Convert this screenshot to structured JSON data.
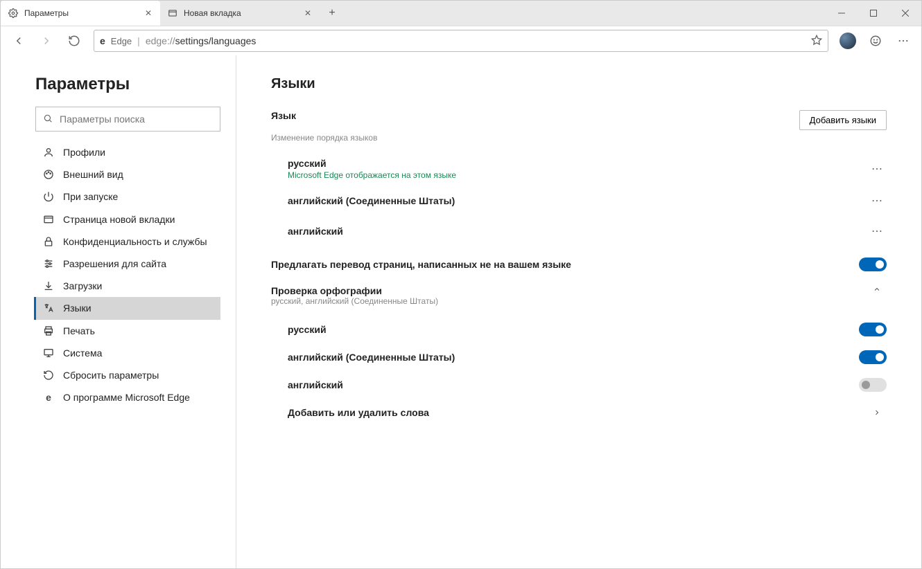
{
  "tabs": [
    {
      "title": "Параметры",
      "active": true
    },
    {
      "title": "Новая вкладка",
      "active": false
    }
  ],
  "toolbar": {
    "app_label": "Edge",
    "url_dim": "edge://",
    "url_path": "settings/languages"
  },
  "sidebar": {
    "title": "Параметры",
    "search_placeholder": "Параметры поиска",
    "items": [
      {
        "id": "profiles",
        "label": "Профили"
      },
      {
        "id": "appearance",
        "label": "Внешний вид"
      },
      {
        "id": "startup",
        "label": "При запуске"
      },
      {
        "id": "newtab",
        "label": "Страница новой вкладки"
      },
      {
        "id": "privacy",
        "label": "Конфиденциальность и службы"
      },
      {
        "id": "site-perm",
        "label": "Разрешения для сайта"
      },
      {
        "id": "downloads",
        "label": "Загрузки"
      },
      {
        "id": "languages",
        "label": "Языки"
      },
      {
        "id": "print",
        "label": "Печать"
      },
      {
        "id": "system",
        "label": "Система"
      },
      {
        "id": "reset",
        "label": "Сбросить параметры"
      },
      {
        "id": "about",
        "label": "О программе Microsoft Edge"
      }
    ]
  },
  "main": {
    "title": "Языки",
    "language_section": {
      "heading": "Язык",
      "subheading": "Изменение порядка языков",
      "add_button": "Добавить языки",
      "items": [
        {
          "name": "русский",
          "note": "Microsoft Edge отображается на этом языке"
        },
        {
          "name": "английский (Соединенные Штаты)"
        },
        {
          "name": "английский"
        }
      ]
    },
    "translate": {
      "label": "Предлагать перевод страниц, написанных не на вашем языке",
      "enabled": true
    },
    "spellcheck": {
      "heading": "Проверка орфографии",
      "subheading": "русский, английский (Соединенные Штаты)",
      "expanded": true,
      "items": [
        {
          "name": "русский",
          "enabled": true
        },
        {
          "name": "английский (Соединенные Штаты)",
          "enabled": true
        },
        {
          "name": "английский",
          "enabled": false
        }
      ],
      "dictionary_label": "Добавить или удалить слова"
    }
  }
}
